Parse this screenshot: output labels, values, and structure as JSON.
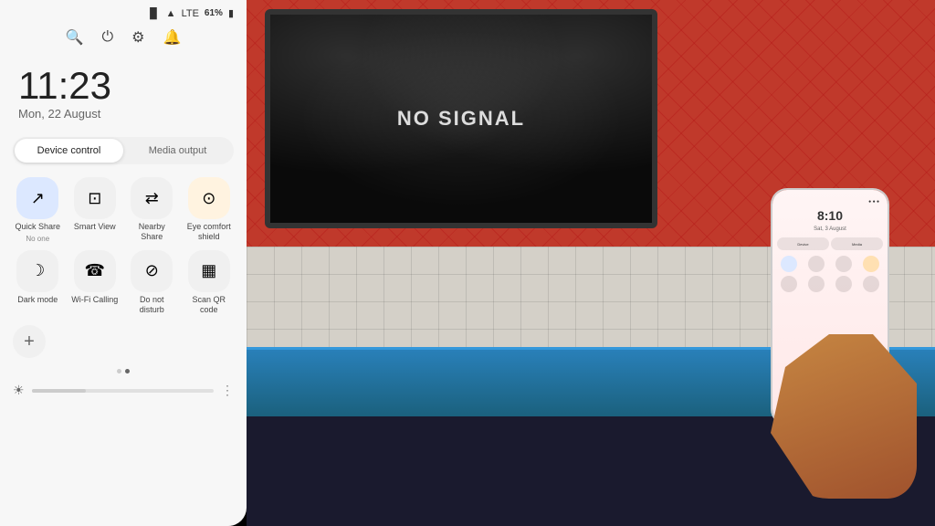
{
  "status_bar": {
    "signal": "📶",
    "battery": "61%",
    "battery_icon": "🔋"
  },
  "top_icons": {
    "search": "🔍",
    "power": "⏻",
    "settings": "⚙",
    "notification": "🔔"
  },
  "time": {
    "clock": "11:23",
    "date": "Mon, 22 August"
  },
  "control_tabs": {
    "device": "Device control",
    "media": "Media output"
  },
  "tiles": [
    {
      "id": "quick-share",
      "icon": "↗",
      "label": "Quick Share",
      "sublabel": "No one"
    },
    {
      "id": "smart-view",
      "icon": "📺",
      "label": "Smart View",
      "sublabel": ""
    },
    {
      "id": "nearby-share",
      "icon": "⇄",
      "label": "Nearby Share",
      "sublabel": ""
    },
    {
      "id": "eye-comfort",
      "icon": "☀",
      "label": "Eye comfort shield",
      "sublabel": ""
    },
    {
      "id": "dark-mode",
      "icon": "🌙",
      "label": "Dark mode",
      "sublabel": ""
    },
    {
      "id": "wifi-calling",
      "icon": "📞",
      "label": "Wi-Fi Calling",
      "sublabel": ""
    },
    {
      "id": "do-not-disturb",
      "icon": "⊘",
      "label": "Do not disturb",
      "sublabel": ""
    },
    {
      "id": "scan-qr",
      "icon": "▦",
      "label": "Scan QR code",
      "sublabel": ""
    }
  ],
  "add_button": "+",
  "pagination": [
    false,
    true
  ],
  "brightness": {
    "level": 30,
    "icon": "☀"
  },
  "phone_screen": {
    "time": "8:10",
    "date": "Sat, 3 August",
    "tab1": "Device control",
    "tab2": "Media output"
  },
  "tv": {
    "no_signal": "NO SIGNAL"
  }
}
